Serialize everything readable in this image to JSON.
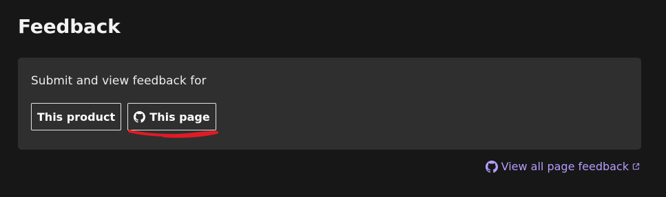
{
  "header": {
    "title": "Feedback"
  },
  "feedback_panel": {
    "prompt": "Submit and view feedback for",
    "buttons": [
      {
        "label": "This product",
        "icon": null
      },
      {
        "label": "This page",
        "icon": "github-icon"
      }
    ]
  },
  "footer": {
    "view_all_link": {
      "label": "View all page feedback",
      "leading_icon": "github-icon",
      "trailing_icon": "external-link-icon"
    }
  },
  "colors": {
    "background": "#171717",
    "panel": "#2f2f2f",
    "text": "#ececec",
    "link": "#b69cff",
    "annotation": "#e01b24"
  }
}
